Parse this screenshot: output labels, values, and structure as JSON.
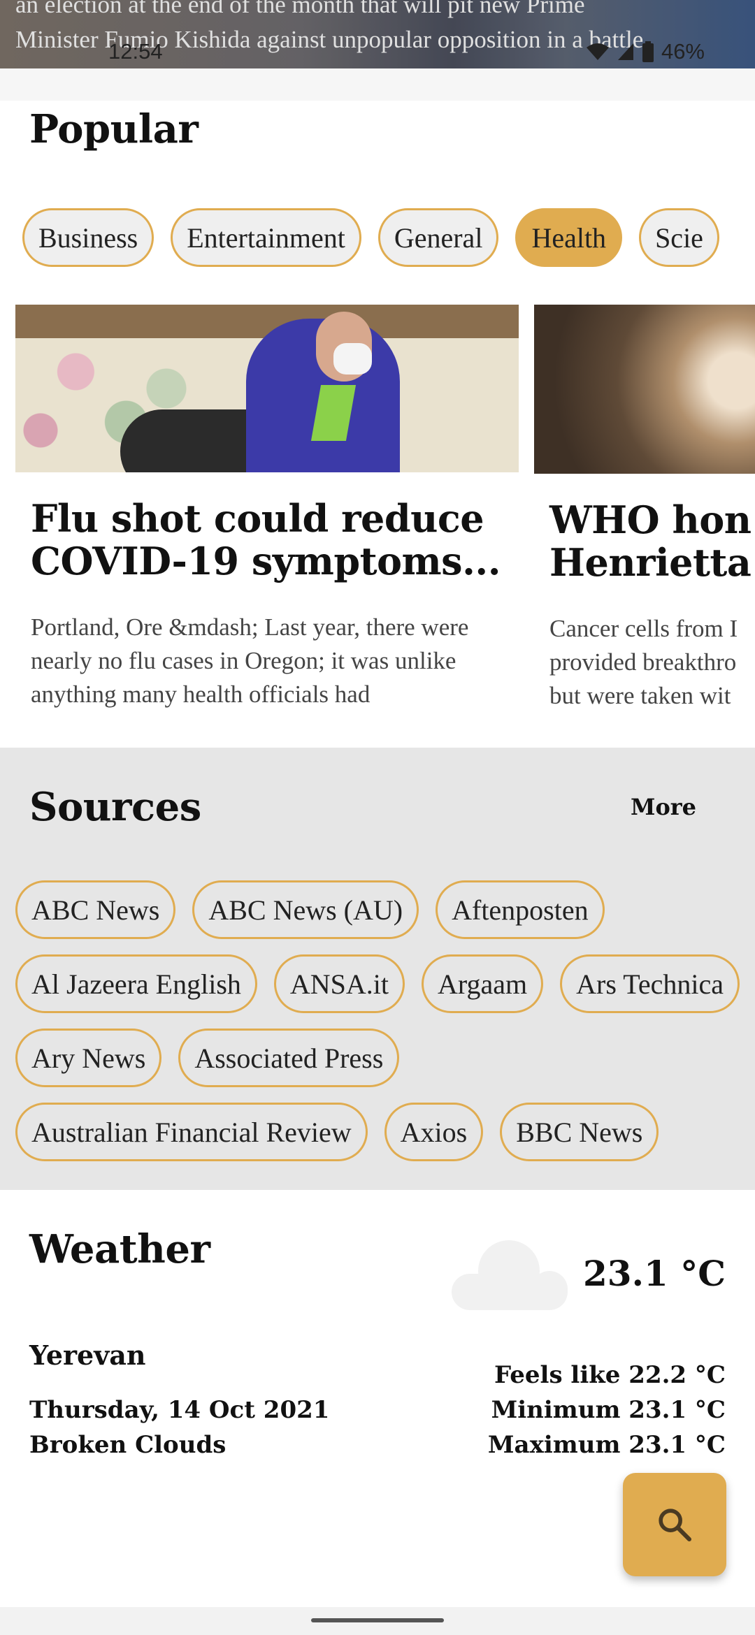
{
  "hero": {
    "text_line1": "an election at the end of the month that will pit new Prime",
    "text_line2": "Minister Fumio Kishida against unpopular opposition in a battle"
  },
  "status_bar": {
    "time": "12:54",
    "battery": "46%"
  },
  "popular": {
    "title": "Popular",
    "categories": [
      {
        "label": "Business",
        "active": false
      },
      {
        "label": "Entertainment",
        "active": false
      },
      {
        "label": "General",
        "active": false
      },
      {
        "label": "Health",
        "active": true
      },
      {
        "label": "Scie",
        "active": false
      }
    ],
    "articles": [
      {
        "title_line1": "Flu shot could reduce",
        "title_line2": "COVID-19 symptoms...",
        "description": "Portland, Ore &mdash; Last year, there were nearly no flu cases in Oregon; it was unlike anything many health officials had"
      },
      {
        "title_line1": "WHO hon",
        "title_line2": "Henrietta",
        "description_line1": "Cancer cells from I",
        "description_line2": "provided breakthro",
        "description_line3": "but were taken wit"
      }
    ]
  },
  "sources": {
    "title": "Sources",
    "more_label": "More",
    "items": [
      "ABC News",
      "ABC News (AU)",
      "Aftenposten",
      "Al Jazeera English",
      "ANSA.it",
      "Argaam",
      "Ars Technica",
      "Ary News",
      "Associated Press",
      "Australian Financial Review",
      "Axios",
      "BBC News"
    ]
  },
  "weather": {
    "title": "Weather",
    "temperature": "23.1 °C",
    "city": "Yerevan",
    "date": "Thursday, 14 Oct 2021",
    "condition": "Broken Clouds",
    "feels_like": "Feels like 22.2 °C",
    "minimum": "Minimum 23.1 °C",
    "maximum": "Maximum 23.1 °C",
    "icon": "cloud-icon"
  },
  "fab": {
    "icon": "search-icon"
  },
  "colors": {
    "accent": "#e0ac50",
    "sources_bg": "#e6e6e6",
    "chip_bg": "#efefef"
  }
}
